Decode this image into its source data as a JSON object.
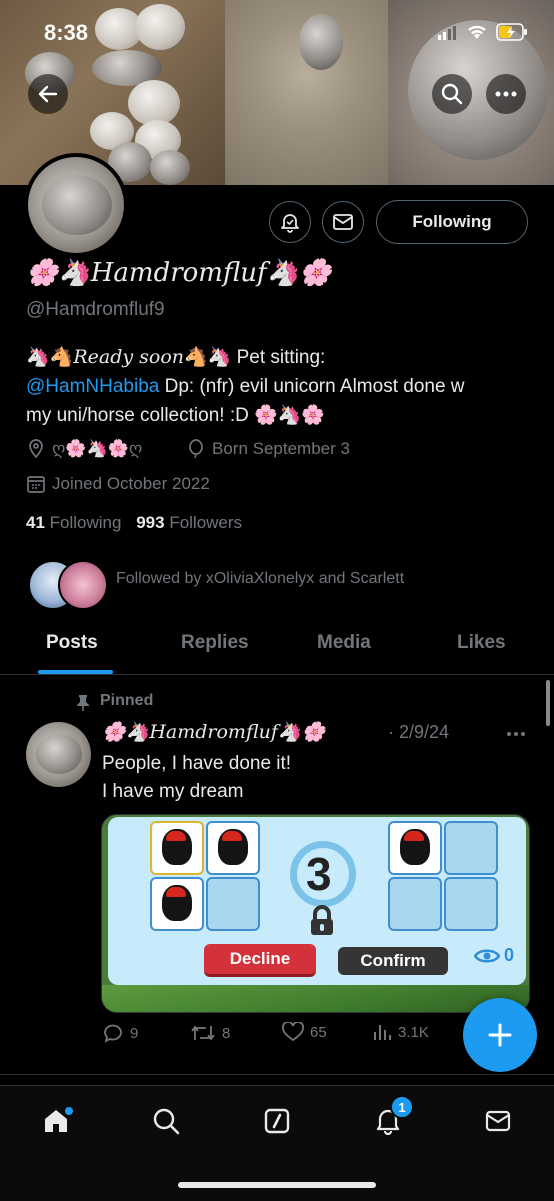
{
  "status": {
    "time": "8:38"
  },
  "profile": {
    "display_name_prefix": "🌸🦄",
    "display_name": "Hamdromfluf",
    "display_name_suffix": "🦄🌸",
    "handle": "@Hamdromfluf9",
    "bio_line1_emoji": "🦄🐴",
    "bio_ready": "Ready soon",
    "bio_line1_emoji2": "🐴🦄",
    "bio_line1_text": " Pet sitting:",
    "bio_link": "@HamNHabiba",
    "bio_line2_text": " Dp: (nfr) evil unicorn Almost done w",
    "bio_line3_text": "my uni/horse collection! :D",
    "bio_line3_emoji": " 🌸🦄🌸",
    "location": "ღ🌸🦄🌸ღ",
    "birthday": "Born September 3",
    "joined": "Joined October 2022",
    "following_count": "41",
    "following_label": "Following",
    "followers_count": "993",
    "followers_label": "Followers",
    "followed_by": "Followed by xOliviaXlonelyx and Scarlett"
  },
  "header": {
    "follow_button": "Following"
  },
  "tabs": [
    {
      "label": "Posts"
    },
    {
      "label": "Replies"
    },
    {
      "label": "Media"
    },
    {
      "label": "Likes"
    }
  ],
  "post": {
    "pinned_label": "Pinned",
    "author_prefix": "🌸🦄",
    "author_name": "Hamdromfluf",
    "author_suffix": "🦄🌸",
    "date": "· 2/9/24",
    "text_line1": "People, I have done it!",
    "text_line2": "I have my dream",
    "media": {
      "counter": "3",
      "decline_label": "Decline",
      "confirm_label": "Confirm",
      "viewers": "0"
    },
    "replies": "9",
    "reposts": "8",
    "likes": "65",
    "views": "3.1K"
  },
  "nav": {
    "notification_badge": "1"
  },
  "colors": {
    "accent": "#1d9bf0",
    "muted": "#71767b",
    "text": "#e7e9ea",
    "background": "#000000"
  }
}
